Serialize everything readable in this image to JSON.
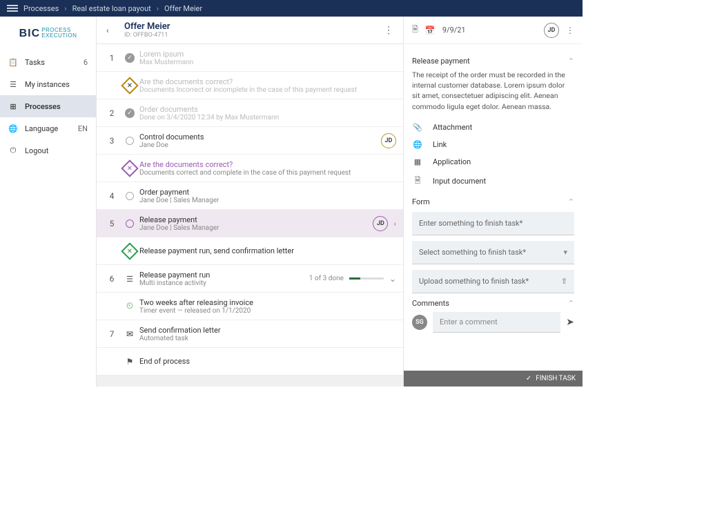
{
  "breadcrumb": [
    "Processes",
    "Real estate loan payout",
    "Offer Meier"
  ],
  "logo": {
    "main": "BIC",
    "line1": "PROCESS",
    "line2": "EXECUTION"
  },
  "nav": {
    "tasks": {
      "label": "Tasks",
      "count": "6"
    },
    "instances": {
      "label": "My instances"
    },
    "processes": {
      "label": "Processes"
    },
    "language": {
      "label": "Language",
      "badge": "EN"
    },
    "logout": {
      "label": "Logout"
    }
  },
  "header": {
    "title": "Offer Meier",
    "id": "ID: OFFBO-4711"
  },
  "steps": [
    {
      "num": "1",
      "kind": "done",
      "title": "Lorem ipsum",
      "sub": "Max Mustermann"
    },
    {
      "kind": "gate-amber",
      "title": "Are the documents correct?",
      "sub": "Documents Incorrect or incomplete in the case of this payment request"
    },
    {
      "num": "2",
      "kind": "done",
      "title": "Order documents",
      "sub": "Done on 3/4/2020 12:34 by Max Mustermann"
    },
    {
      "num": "3",
      "kind": "open",
      "title": "Control documents",
      "sub": "Jane Doe",
      "badge": "JD"
    },
    {
      "kind": "gate-purple",
      "title": "Are the documents correct?",
      "sub": "Documents correct and complete in the case of this payment request"
    },
    {
      "num": "4",
      "kind": "open",
      "title": "Order payment",
      "sub": "Jane Doe | Sales Manager"
    },
    {
      "num": "5",
      "kind": "current",
      "title": "Release payment",
      "sub": "Jane Doe | Sales Manager",
      "badge": "JD"
    },
    {
      "kind": "gate-green",
      "title": "Release payment run, send confirmation letter"
    },
    {
      "num": "6",
      "kind": "multi",
      "title": "Release payment run",
      "sub": "Multi instance activity",
      "progress": "1 of 3 done"
    },
    {
      "kind": "timer",
      "title": "Two weeks after releasing invoice",
      "sub": "Timer event — released on 1/1/2020"
    },
    {
      "num": "7",
      "kind": "auto",
      "title": "Send confirmation letter",
      "sub": "Automated task"
    },
    {
      "kind": "end",
      "title": "End of process"
    }
  ],
  "right": {
    "date": "9/9/21",
    "avatar": "JD",
    "section_title": "Release payment",
    "description": "The receipt of the order must be recorded in the internal customer database. Lorem ipsum dolor sit amet, consectetuer adipiscing elit. Aenean commodo ligula eget dolor. Aenean massa.",
    "info": {
      "attachment": "Attachment",
      "link": "Link",
      "application": "Application",
      "input_doc": "Input document"
    },
    "form_label": "Form",
    "fields": {
      "text": "Enter something to finish task*",
      "select": "Select something to finish task*",
      "upload": "Upload something to finish task*"
    },
    "comments_label": "Comments",
    "comment_placeholder": "Enter a comment",
    "comment_avatar": "SG",
    "finish": "FINISH TASK"
  }
}
